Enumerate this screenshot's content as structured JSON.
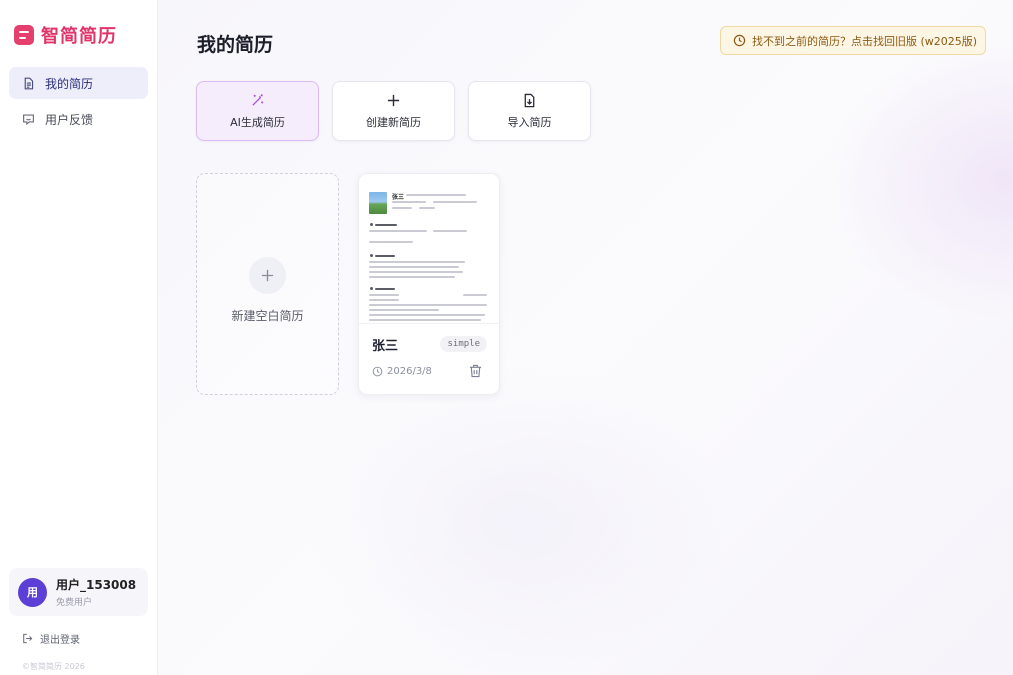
{
  "brand": {
    "name": "智简简历"
  },
  "sidebar": {
    "items": [
      {
        "label": "我的简历",
        "icon": "document-icon",
        "active": true
      },
      {
        "label": "用户反馈",
        "icon": "feedback-icon",
        "active": false
      }
    ]
  },
  "user": {
    "avatar_text": "用",
    "name": "用户_153008",
    "tier": "免费用户"
  },
  "logout_label": "退出登录",
  "copyright": "©智简简历 2026",
  "main": {
    "title": "我的简历",
    "notice": "找不到之前的简历？点击找回旧版 (w2025版)",
    "actions": [
      {
        "label": "AI生成简历",
        "icon": "magic-wand-icon"
      },
      {
        "label": "创建新简历",
        "icon": "plus-icon"
      },
      {
        "label": "导入简历",
        "icon": "file-import-icon"
      }
    ],
    "blank_card_label": "新建空白简历",
    "resumes": [
      {
        "name": "张三",
        "template": "simple",
        "date": "2026/3/8",
        "preview_name": "张三"
      }
    ]
  },
  "colors": {
    "brand": "#e0356a",
    "accent": "#5b3fd6",
    "nav_active_bg": "#eeeefb",
    "ai_button_bg": "#f5edfc",
    "notice_bg": "#fdf6e4",
    "notice_text": "#8c5a12"
  }
}
